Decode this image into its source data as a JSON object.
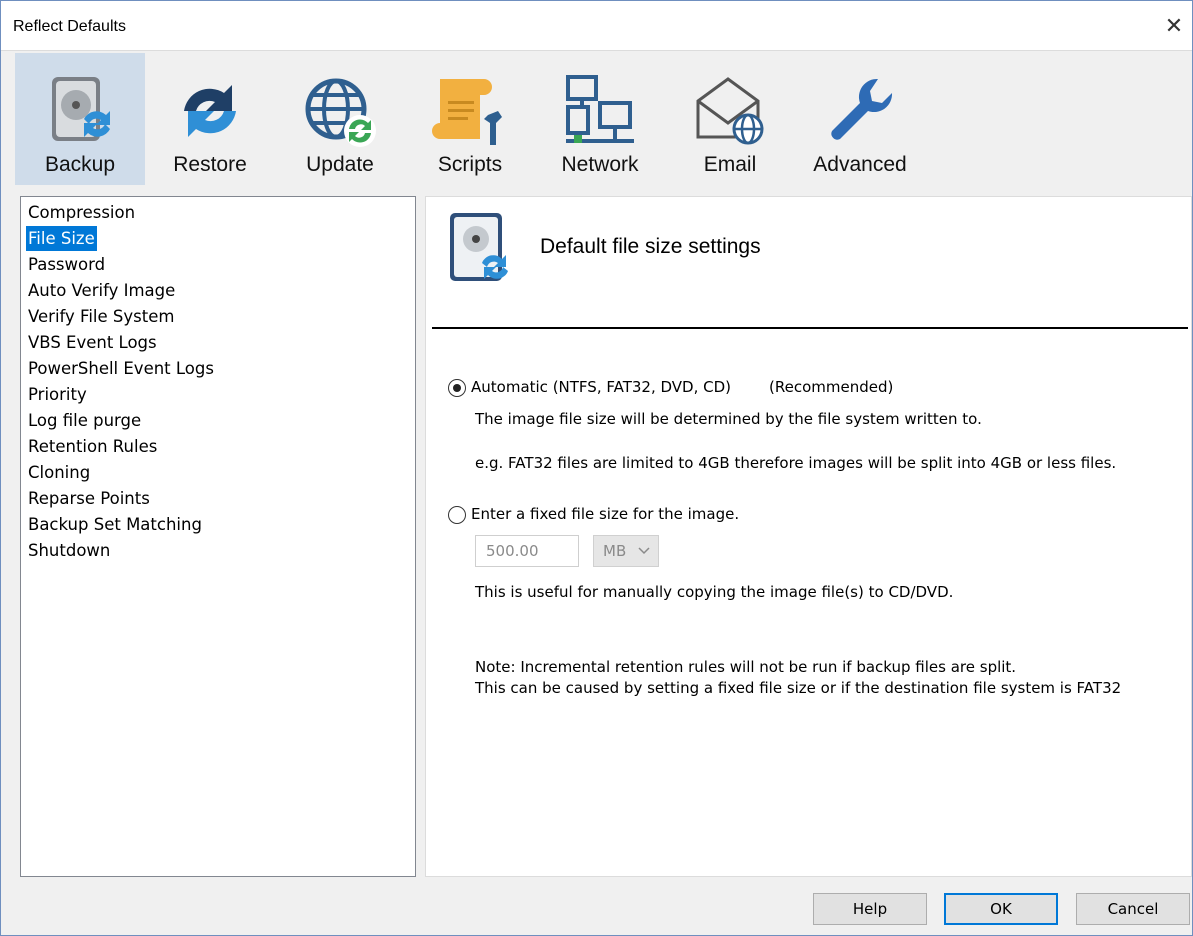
{
  "window": {
    "title": "Reflect Defaults",
    "close_glyph": "✕"
  },
  "toolbar": {
    "items": [
      {
        "label": "Backup",
        "icon": "backup-disk-icon",
        "selected": true
      },
      {
        "label": "Restore",
        "icon": "restore-arrows-icon"
      },
      {
        "label": "Update",
        "icon": "update-globe-icon"
      },
      {
        "label": "Scripts",
        "icon": "scripts-scroll-icon"
      },
      {
        "label": "Network",
        "icon": "network-computers-icon"
      },
      {
        "label": "Email",
        "icon": "email-envelope-icon"
      },
      {
        "label": "Advanced",
        "icon": "wrench-icon"
      }
    ]
  },
  "sidebar": {
    "items": [
      {
        "label": "Compression"
      },
      {
        "label": "File Size",
        "selected": true
      },
      {
        "label": "Password"
      },
      {
        "label": "Auto Verify Image"
      },
      {
        "label": "Verify File System"
      },
      {
        "label": "VBS Event Logs"
      },
      {
        "label": "PowerShell Event Logs"
      },
      {
        "label": "Priority"
      },
      {
        "label": "Log file purge"
      },
      {
        "label": "Retention Rules"
      },
      {
        "label": "Cloning"
      },
      {
        "label": "Reparse Points"
      },
      {
        "label": "Backup Set Matching"
      },
      {
        "label": "Shutdown"
      }
    ]
  },
  "main": {
    "header_title": "Default file size settings",
    "header_icon": "backup-disk-icon",
    "option_auto": {
      "label": "Automatic (NTFS, FAT32, DVD, CD)",
      "tag": "(Recommended)",
      "checked": true,
      "desc1": "The image file size will be determined by the file system written to.",
      "desc2": "e.g. FAT32 files are limited to 4GB therefore images will be split into 4GB or less files."
    },
    "option_fixed": {
      "label": "Enter a fixed file size for the image.",
      "checked": false,
      "size_value": "500.00",
      "unit_value": "MB",
      "desc": "This is useful for manually copying the image file(s) to CD/DVD."
    },
    "note_line1": "Note: Incremental retention rules will not be run if backup files are split.",
    "note_line2": "This can be caused by setting a fixed file size or if the destination file system is FAT32"
  },
  "buttons": {
    "help": "Help",
    "ok": "OK",
    "cancel": "Cancel"
  },
  "colors": {
    "selection": "#0078d7",
    "toolbar_selected": "#cfdcea",
    "icon_blue": "#2e6bb5",
    "icon_orange": "#f0a830"
  }
}
